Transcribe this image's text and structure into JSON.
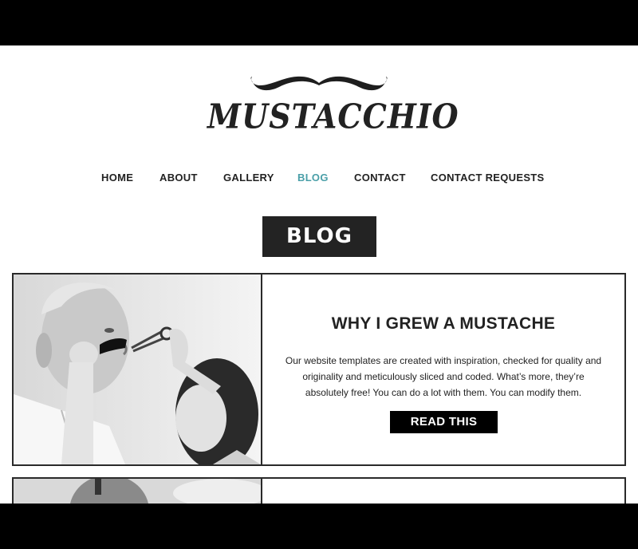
{
  "brand": {
    "name": "MUSTACCHIO",
    "logo_icon": "mustache-icon"
  },
  "nav": {
    "items": [
      {
        "label": "HOME",
        "active": false
      },
      {
        "label": "ABOUT",
        "active": false
      },
      {
        "label": "GALLERY",
        "active": false
      },
      {
        "label": "BLOG",
        "active": true
      },
      {
        "label": "CONTACT",
        "active": false
      },
      {
        "label": "CONTACT REQUESTS",
        "active": false
      }
    ]
  },
  "page": {
    "title": "BLOG"
  },
  "posts": [
    {
      "title": "WHY I GREW A MUSTACHE",
      "excerpt": "Our website templates are created with inspiration, checked for quality and originality and meticulously sliced and coded. What’s more, they’re absolutely free! You can do a lot with them. You can modify them.",
      "button_label": "READ THIS"
    }
  ],
  "colors": {
    "accent": "#4a9fa8",
    "dark": "#232323",
    "frame": "#000000"
  }
}
